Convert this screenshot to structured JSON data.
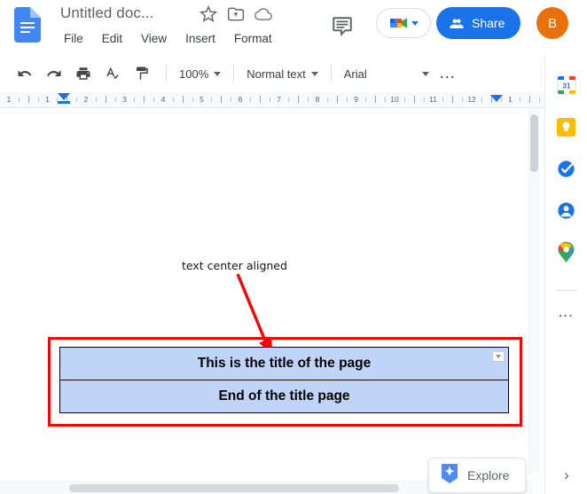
{
  "app": {
    "name": "Google Docs",
    "logo_icon": "docs-logo-icon"
  },
  "header": {
    "doc_title": "Untitled doc...",
    "star_icon": "star-icon",
    "move_icon": "move-to-folder-icon",
    "cloud_icon": "cloud-saved-icon",
    "comment_history_icon": "comment-history-icon",
    "meet_icon": "google-meet-icon",
    "share_label": "Share",
    "share_icon": "share-person-icon",
    "avatar_initial": "B",
    "avatar_color": "#e8710a",
    "share_color": "#1a73e8"
  },
  "menubar": {
    "items": [
      {
        "label": "File"
      },
      {
        "label": "Edit"
      },
      {
        "label": "View"
      },
      {
        "label": "Insert"
      },
      {
        "label": "Format"
      }
    ]
  },
  "toolbar": {
    "icons": [
      {
        "name": "undo-icon"
      },
      {
        "name": "redo-icon"
      },
      {
        "name": "print-icon"
      },
      {
        "name": "spelling-check-icon"
      },
      {
        "name": "paint-format-icon"
      }
    ],
    "zoom_value": "100%",
    "style_value": "Normal text",
    "font_value": "Arial",
    "more_label": "…"
  },
  "ruler": {
    "labels": [
      "1",
      "1",
      "2",
      "3",
      "4",
      "5",
      "6",
      "7",
      "8",
      "9",
      "10",
      "11",
      "12",
      "1"
    ],
    "marker_color": "#1a73e8"
  },
  "document": {
    "annotation": {
      "text": "text center aligned",
      "arrow_color": "#fe0000"
    },
    "highlight_box_color": "#fe0000",
    "table": {
      "cell_background": "#c0d4f8",
      "border_color": "#000000",
      "alignment": "center",
      "rows": [
        {
          "text": "This is the title of the page",
          "has_options_button": true
        },
        {
          "text": "End of the title page",
          "has_options_button": false
        }
      ]
    }
  },
  "explore": {
    "label": "Explore",
    "icon": "explore-star-icon"
  },
  "sidebar": {
    "items": [
      {
        "name": "google-calendar-icon",
        "label": "Calendar",
        "badge": "31"
      },
      {
        "name": "google-keep-icon",
        "label": "Keep"
      },
      {
        "name": "google-tasks-icon",
        "label": "Tasks"
      },
      {
        "name": "google-contacts-icon",
        "label": "Contacts"
      },
      {
        "name": "google-maps-icon",
        "label": "Maps"
      }
    ],
    "more_label": "…",
    "expand_label": "›"
  },
  "scrollbars": {
    "vertical": "vertical-scrollbar",
    "horizontal": "horizontal-scrollbar"
  }
}
